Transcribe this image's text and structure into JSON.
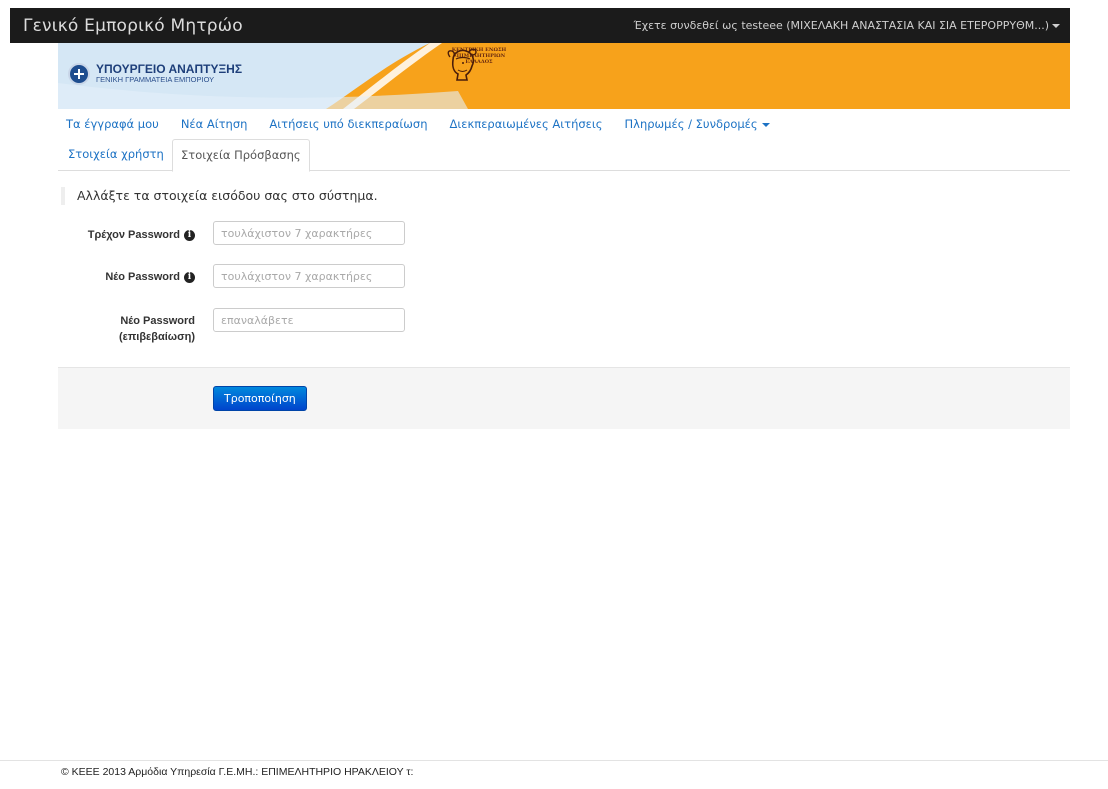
{
  "navbar": {
    "brand": "Γενικό Εμπορικό Μητρώο",
    "user_text": "Έχετε συνδεθεί ως testeee (ΜΙΧΕΛΑΚΗ ΑΝΑΣΤΑΣΙΑ ΚΑΙ ΣΙΑ ΕΤΕΡΟΡΡΥΘΜ...)"
  },
  "banner": {
    "ministry_title": "ΥΠΟΥΡΓΕΙΟ ΑΝΑΠΤΥΞΗΣ",
    "ministry_sub": "ΓΕΝΙΚΗ ΓΡΑΜΜΑΤΕΙΑ ΕΜΠΟΡΙΟΥ",
    "keee_line1": "ΚΕΝΤΡΙΚΗ ΕΝΩΣΗ",
    "keee_line2": "ΕΠΙΜΕΛΗΤΗΡΙΩΝ",
    "keee_line3": "ΕΛΛΑΔΟΣ",
    "colors": {
      "orange": "#f7a21b",
      "light_blue": "#d5e7f5",
      "navy": "#1e3f7a"
    }
  },
  "main_nav": {
    "items": [
      {
        "label": "Τα έγγραφά μου"
      },
      {
        "label": "Νέα Αίτηση"
      },
      {
        "label": "Αιτήσεις υπό διεκπεραίωση"
      },
      {
        "label": "Διεκπεραιωμένες Αιτήσεις"
      },
      {
        "label": "Πληρωμές / Συνδρομές"
      }
    ]
  },
  "tabs": [
    {
      "label": "Στοιχεία χρήστη",
      "active": false
    },
    {
      "label": "Στοιχεία Πρόσβασης",
      "active": true
    }
  ],
  "form": {
    "intro": "Αλλάξτε τα στοιχεία εισόδου σας στο σύστημα.",
    "current_password": {
      "label": "Τρέχον Password",
      "placeholder": "τουλάχιστον 7 χαρακτήρες",
      "value": ""
    },
    "new_password": {
      "label": "Νέο Password",
      "placeholder": "τουλάχιστον 7 χαρακτήρες",
      "value": ""
    },
    "confirm_password": {
      "label_line1": "Νέο Password",
      "label_line2": "(επιβεβαίωση)",
      "placeholder": "επαναλάβετε",
      "value": ""
    },
    "submit_label": "Τροποποίηση"
  },
  "footer": {
    "text": "© ΚΕΕΕ 2013 Αρμόδια Υπηρεσία Γ.Ε.ΜΗ.: ΕΠΙΜΕΛΗΤΗΡΙΟ ΗΡΑΚΛΕΙΟΥ τ:"
  }
}
